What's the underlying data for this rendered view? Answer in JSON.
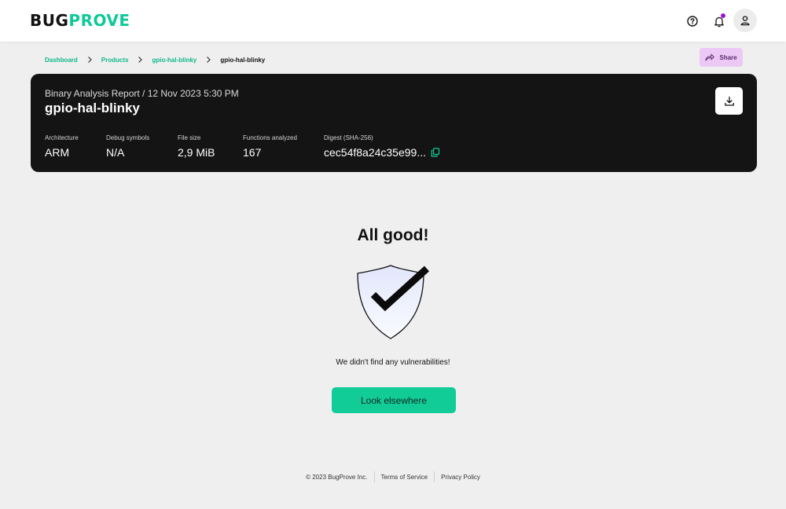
{
  "brand": {
    "part1": "BUG",
    "part2": "PROVE",
    "accent": "#10c99a"
  },
  "header": {
    "icons": [
      "help-circle-icon",
      "bell-icon",
      "user-icon"
    ],
    "notification_dot_color": "#a313d6"
  },
  "breadcrumb": {
    "items": [
      "Dashboard",
      "Products",
      "gpio-hal-blinky",
      "gpio-hal-blinky"
    ]
  },
  "share": {
    "label": "Share",
    "color": "#ecc9f5"
  },
  "report": {
    "subtitle": "Binary Analysis Report / 12 Nov 2023 5:30 PM",
    "title": "gpio-hal-blinky",
    "meta": [
      {
        "label": "Architecture",
        "value": "ARM"
      },
      {
        "label": "Debug symbols",
        "value": "N/A"
      },
      {
        "label": "File size",
        "value": "2,9 MiB"
      },
      {
        "label": "Functions analyzed",
        "value": "167"
      },
      {
        "label": "Digest (SHA-256)",
        "value": "cec54f8a24c35e99..."
      }
    ]
  },
  "result": {
    "title": "All good!",
    "message": "We didn't find any vulnerabilities!",
    "button_label": "Look elsewhere",
    "button_color": "#12cc98"
  },
  "footer": {
    "copyright": "© 2023 BugProve Inc.",
    "terms": "Terms of Service",
    "privacy": "Privacy Policy"
  }
}
